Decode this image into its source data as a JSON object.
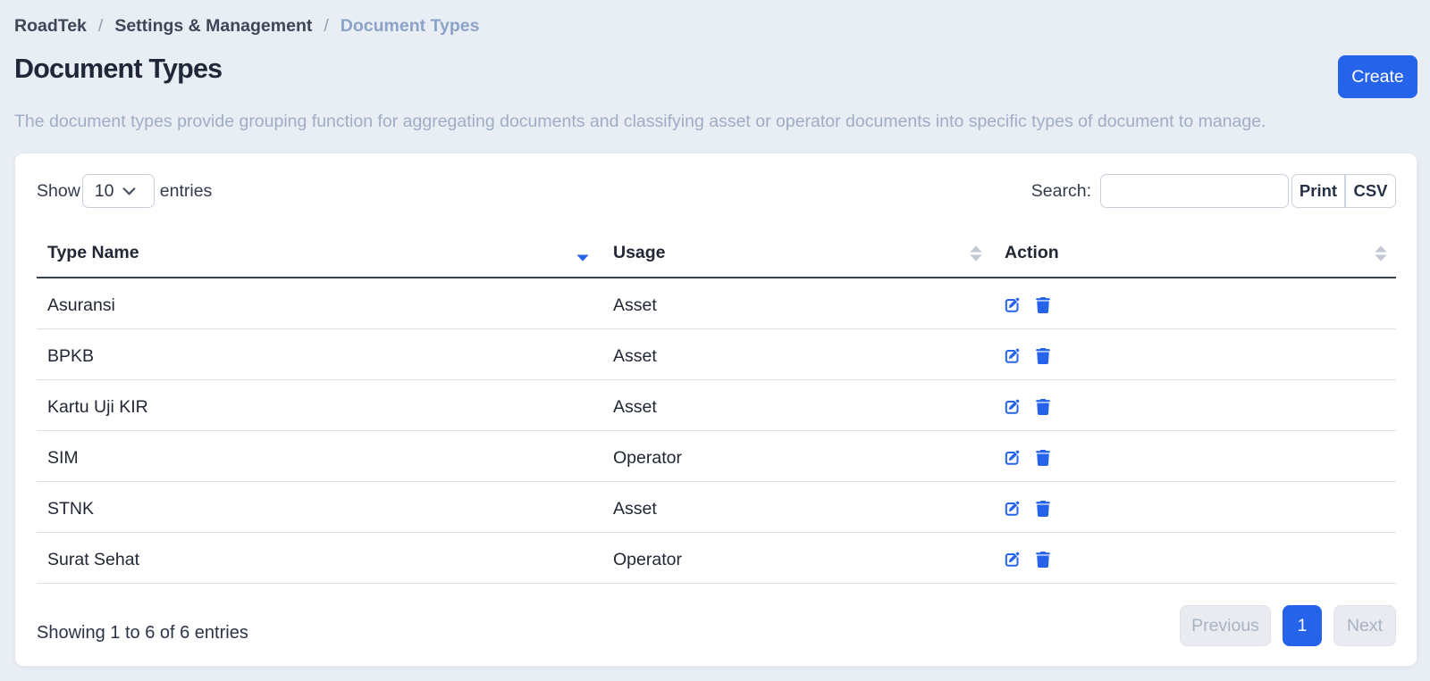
{
  "breadcrumb": {
    "items": [
      {
        "label": "RoadTek"
      },
      {
        "label": "Settings & Management"
      },
      {
        "label": "Document Types"
      }
    ],
    "separator": "/"
  },
  "header": {
    "title": "Document Types",
    "create_label": "Create",
    "description": "The document types provide grouping function for aggregating documents and classifying asset or operator documents into specific types of document to manage."
  },
  "table_controls": {
    "show_label": "Show",
    "page_length": "10",
    "entries_label": "entries",
    "search_label": "Search:",
    "search_value": "",
    "print_label": "Print",
    "csv_label": "CSV"
  },
  "table": {
    "columns": [
      {
        "label": "Type Name",
        "sort": "desc"
      },
      {
        "label": "Usage",
        "sort": "none"
      },
      {
        "label": "Action",
        "sort": "none"
      }
    ],
    "rows": [
      {
        "type_name": "Asuransi",
        "usage": "Asset"
      },
      {
        "type_name": "BPKB",
        "usage": "Asset"
      },
      {
        "type_name": "Kartu Uji KIR",
        "usage": "Asset"
      },
      {
        "type_name": "SIM",
        "usage": "Operator"
      },
      {
        "type_name": "STNK",
        "usage": "Asset"
      },
      {
        "type_name": "Surat Sehat",
        "usage": "Operator"
      }
    ]
  },
  "footer": {
    "info": "Showing 1 to 6 of 6 entries",
    "previous_label": "Previous",
    "page_number": "1",
    "next_label": "Next"
  },
  "colors": {
    "accent_blue": "#2563eb",
    "page_background": "#e9edf4"
  }
}
